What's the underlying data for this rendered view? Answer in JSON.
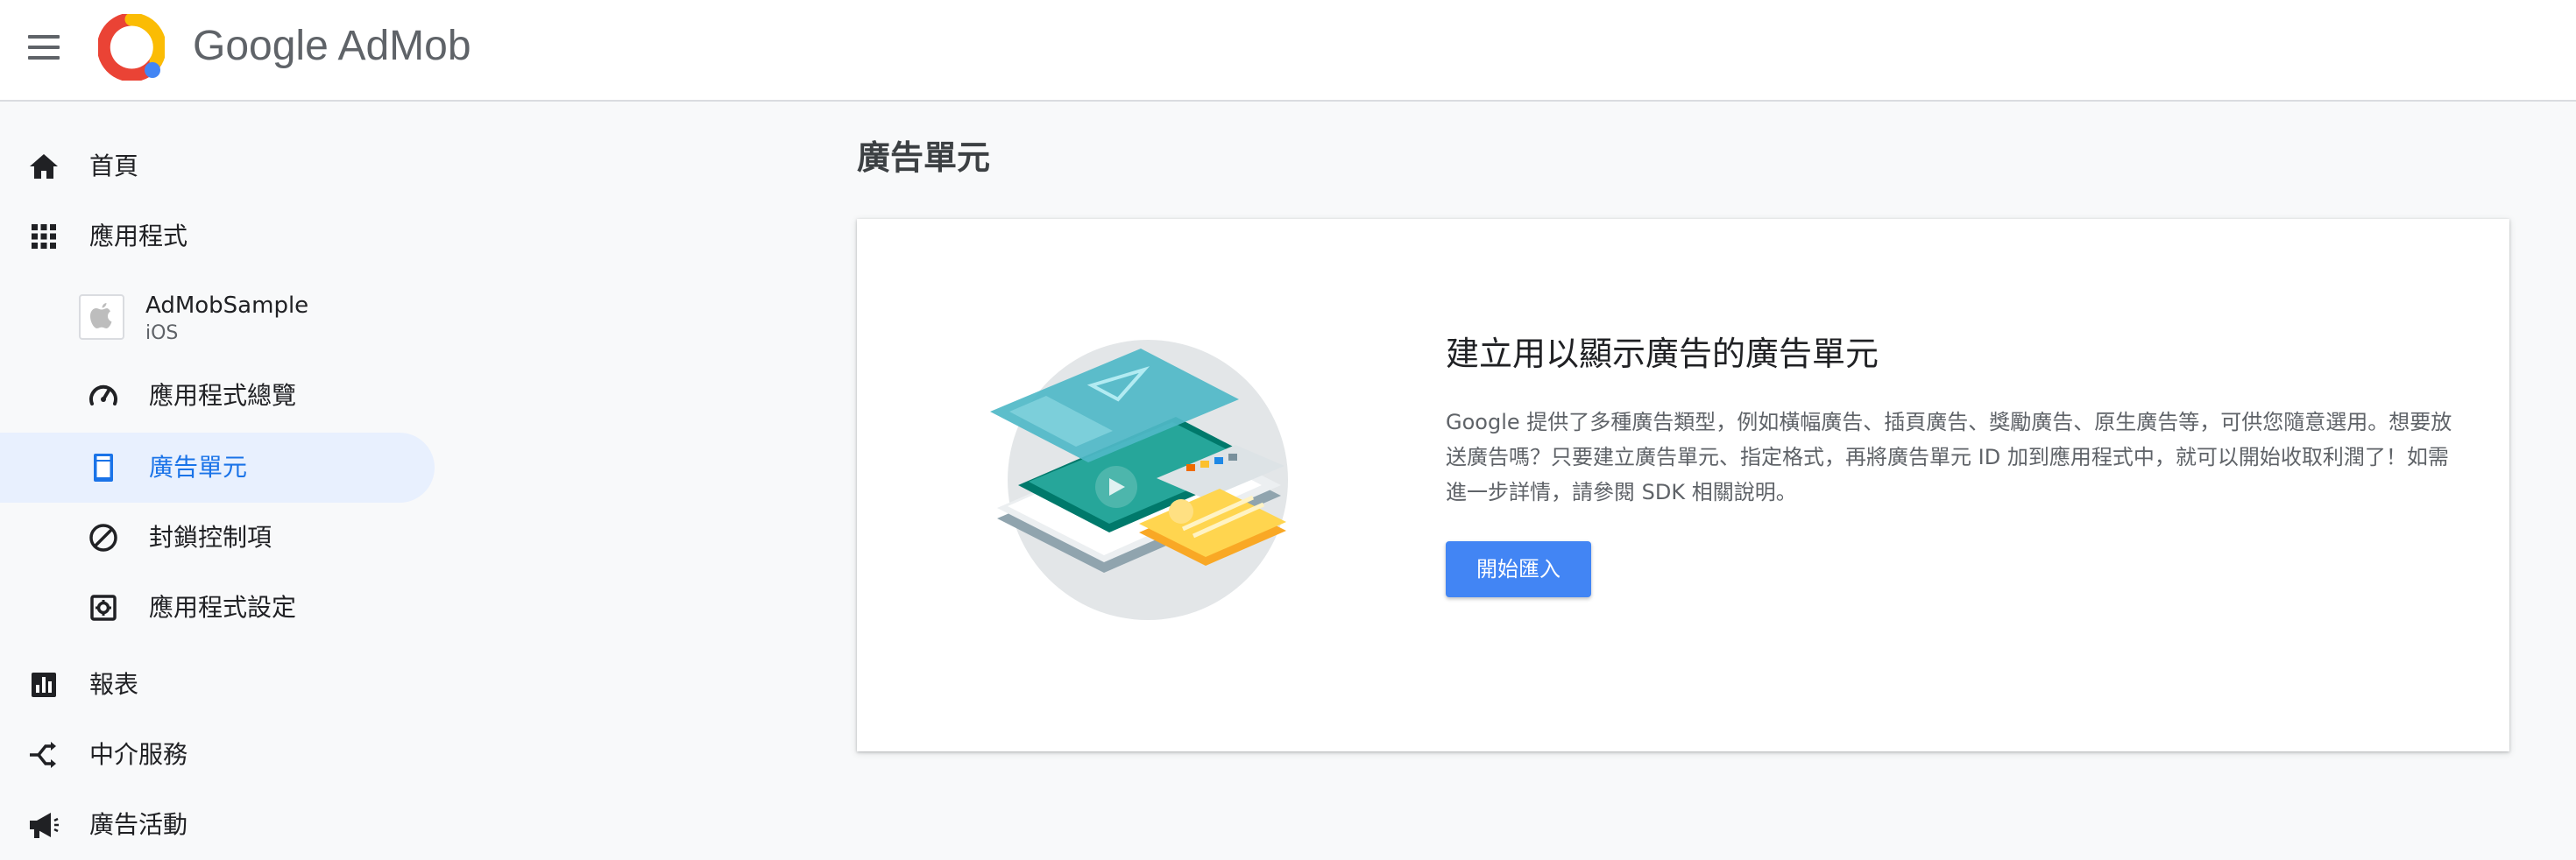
{
  "header": {
    "brand_google": "Google",
    "brand_product": "AdMob",
    "menu_icon": "hamburger-menu-icon",
    "logo_icon": "admob-logo-icon"
  },
  "sidebar": {
    "items": [
      {
        "label": "首頁",
        "icon": "home-icon"
      },
      {
        "label": "應用程式",
        "icon": "apps-grid-icon"
      }
    ],
    "app": {
      "name": "AdMobSample",
      "platform": "iOS",
      "icon": "apple-icon"
    },
    "sub_items": [
      {
        "label": "應用程式總覽",
        "icon": "speedometer-icon"
      },
      {
        "label": "廣告單元",
        "icon": "ad-unit-icon",
        "active": true
      },
      {
        "label": "封鎖控制項",
        "icon": "block-icon"
      },
      {
        "label": "應用程式設定",
        "icon": "settings-icon"
      }
    ],
    "bottom_items": [
      {
        "label": "報表",
        "icon": "bar-chart-icon"
      },
      {
        "label": "中介服務",
        "icon": "mediation-icon"
      },
      {
        "label": "廣告活動",
        "icon": "megaphone-icon"
      }
    ]
  },
  "main": {
    "title": "廣告單元",
    "card": {
      "heading": "建立用以顯示廣告的廣告單元",
      "description": "Google 提供了多種廣告類型，例如橫幅廣告、插頁廣告、獎勵廣告、原生廣告等，可供您隨意選用。想要放送廣告嗎？只要建立廣告單元、指定格式，再將廣告單元 ID 加到應用程式中，就可以開始收取利潤了！如需進一步詳情，請參閱 SDK 相關說明。",
      "button_label": "開始匯入",
      "illustration": "ad-formats-illustration"
    }
  },
  "colors": {
    "accent": "#1a73e8",
    "button": "#4285f4",
    "active_bg": "#e8f0fe",
    "logo_orange": "#ea4335",
    "logo_yellow": "#fbbc04",
    "logo_blue": "#4285f4"
  }
}
